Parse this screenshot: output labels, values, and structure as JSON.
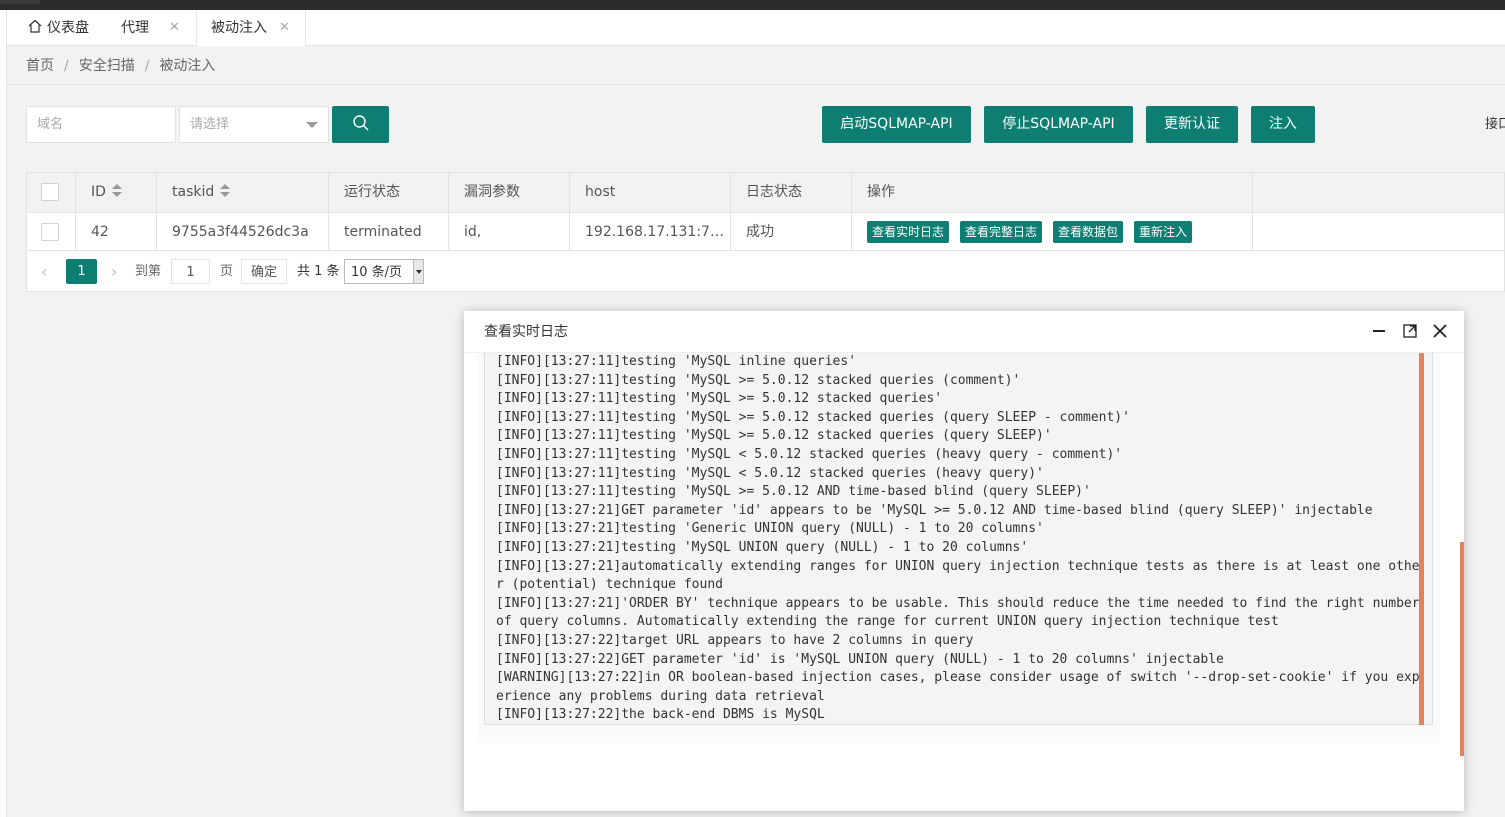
{
  "tabs": [
    {
      "label": "仪表盘",
      "closable": false
    },
    {
      "label": "代理",
      "closable": true
    },
    {
      "label": "被动注入",
      "closable": true,
      "active": true
    }
  ],
  "breadcrumb": [
    "首页",
    "安全扫描",
    "被动注入"
  ],
  "filters": {
    "domain_placeholder": "域名",
    "select_placeholder": "请选择"
  },
  "actions": {
    "start": "启动SQLMAP-API",
    "stop": "停止SQLMAP-API",
    "update_auth": "更新认证",
    "inject": "注入",
    "cut_label": "接口"
  },
  "table": {
    "columns": [
      "ID",
      "taskid",
      "运行状态",
      "漏洞参数",
      "host",
      "日志状态",
      "操作"
    ],
    "rows": [
      {
        "id": "42",
        "taskid": "9755a3f44526dc3a",
        "run_status": "terminated",
        "vuln_param": "id,",
        "host": "192.168.17.131:7…",
        "log_status": "成功",
        "ops": [
          "查看实时日志",
          "查看完整日志",
          "查看数据包",
          "重新注入"
        ]
      }
    ]
  },
  "pagination": {
    "current_page": "1",
    "goto_label": "到第",
    "goto_value": "1",
    "page_unit": "页",
    "confirm": "确定",
    "total": "共 1 条",
    "page_size": "10 条/页"
  },
  "modal": {
    "title": "查看实时日志",
    "log_lines": [
      "[INFO][13:27:11]testing 'MySQL inline queries'",
      "[INFO][13:27:11]testing 'MySQL >= 5.0.12 stacked queries (comment)'",
      "[INFO][13:27:11]testing 'MySQL >= 5.0.12 stacked queries'",
      "[INFO][13:27:11]testing 'MySQL >= 5.0.12 stacked queries (query SLEEP - comment)'",
      "[INFO][13:27:11]testing 'MySQL >= 5.0.12 stacked queries (query SLEEP)'",
      "[INFO][13:27:11]testing 'MySQL < 5.0.12 stacked queries (heavy query - comment)'",
      "[INFO][13:27:11]testing 'MySQL < 5.0.12 stacked queries (heavy query)'",
      "[INFO][13:27:11]testing 'MySQL >= 5.0.12 AND time-based blind (query SLEEP)'",
      "[INFO][13:27:21]GET parameter 'id' appears to be 'MySQL >= 5.0.12 AND time-based blind (query SLEEP)' injectable",
      "[INFO][13:27:21]testing 'Generic UNION query (NULL) - 1 to 20 columns'",
      "[INFO][13:27:21]testing 'MySQL UNION query (NULL) - 1 to 20 columns'",
      "[INFO][13:27:21]automatically extending ranges for UNION query injection technique tests as there is at least one other (potential) technique found",
      "[INFO][13:27:21]'ORDER BY' technique appears to be usable. This should reduce the time needed to find the right number of query columns. Automatically extending the range for current UNION query injection technique test",
      "[INFO][13:27:22]target URL appears to have 2 columns in query",
      "[INFO][13:27:22]GET parameter 'id' is 'MySQL UNION query (NULL) - 1 to 20 columns' injectable",
      "[WARNING][13:27:22]in OR boolean-based injection cases, please consider usage of switch '--drop-set-cookie' if you experience any problems during data retrieval",
      "[INFO][13:27:22]the back-end DBMS is MySQL"
    ]
  },
  "icons": {
    "home": "home-icon",
    "close": "close-icon",
    "search": "search-icon",
    "minimize": "minimize-icon",
    "maximize": "maximize-icon"
  },
  "colors": {
    "primary": "#0f7e72",
    "scrollbar": "#e4825a"
  }
}
